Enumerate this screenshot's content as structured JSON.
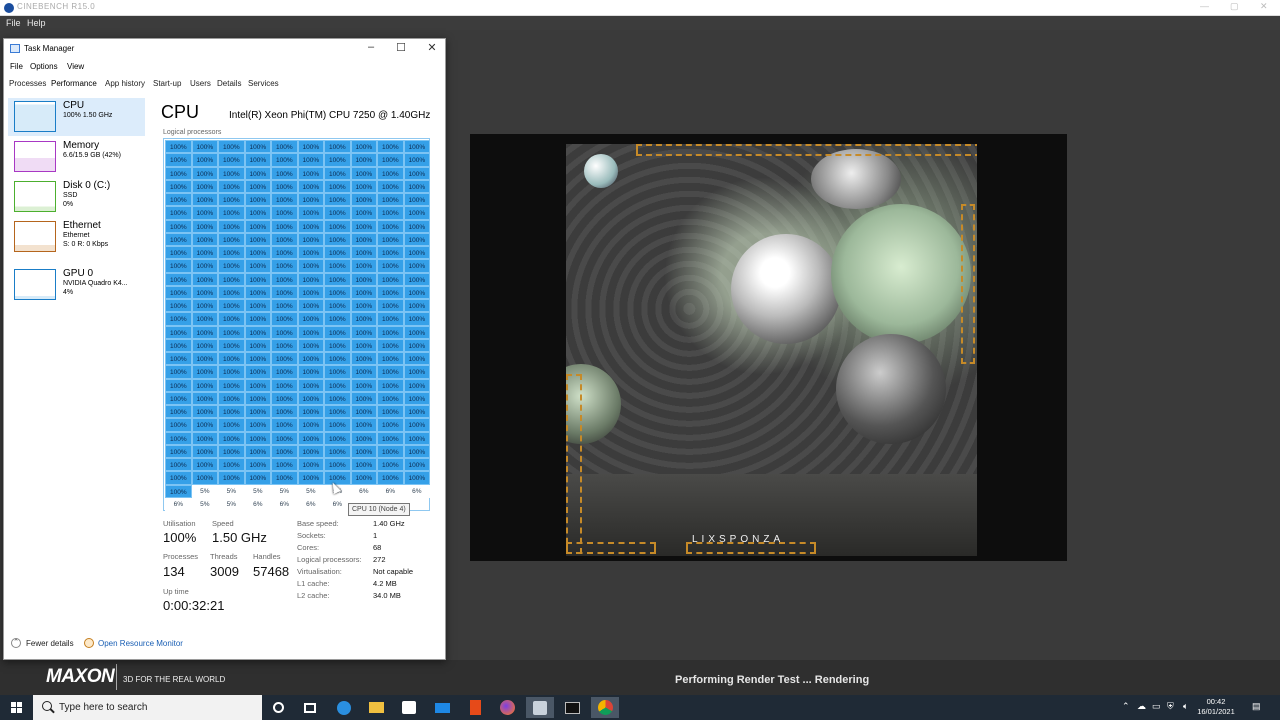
{
  "host": {
    "title": "CINEBENCH R15.0",
    "menu": [
      "File",
      "Help"
    ],
    "bottom_logo": "MAXON",
    "bottom_tagline": "3D FOR THE REAL WORLD",
    "status": "Performing Render Test ... Rendering",
    "render_brand": "LIXSPONZA"
  },
  "taskmgr": {
    "title": "Task Manager",
    "menu": [
      "File",
      "Options",
      "View"
    ],
    "tabs": [
      "Processes",
      "Performance",
      "App history",
      "Start-up",
      "Users",
      "Details",
      "Services"
    ],
    "active_tab": "Performance",
    "sidebar": [
      {
        "name": "CPU",
        "s1": "100% 1.50 GHz",
        "s2": "",
        "color": "#1a7dc7"
      },
      {
        "name": "Memory",
        "s1": "6.6/15.9 GB (42%)",
        "s2": "",
        "color": "#a838c4"
      },
      {
        "name": "Disk 0 (C:)",
        "s1": "SSD",
        "s2": "0%",
        "color": "#4caf2e"
      },
      {
        "name": "Ethernet",
        "s1": "Ethernet",
        "s2": "S: 0 R: 0 Kbps",
        "color": "#b5651d"
      },
      {
        "name": "GPU 0",
        "s1": "NVIDIA Quadro K4...",
        "s2": "4%",
        "color": "#1a7dc7"
      }
    ],
    "cpu_heading": "CPU",
    "cpu_model": "Intel(R) Xeon Phi(TM) CPU 7250 @ 1.40GHz",
    "lp_label": "Logical processors",
    "lp_busy_label": "100%",
    "lp_busy_count": 261,
    "lp_idle_values": [
      "5%",
      "5%",
      "5%",
      "5%",
      "5%",
      "5%",
      "6%",
      "6%",
      "6%",
      "6%",
      "5%",
      "5%",
      "6%",
      "6%",
      "6%",
      "6%"
    ],
    "tooltip": "CPU 10 (Node 4)",
    "stats": {
      "utilisation_label": "Utilisation",
      "utilisation": "100%",
      "speed_label": "Speed",
      "speed": "1.50 GHz",
      "processes_label": "Processes",
      "processes": "134",
      "threads_label": "Threads",
      "threads": "3009",
      "handles_label": "Handles",
      "handles": "57468",
      "uptime_label": "Up time",
      "uptime": "0:00:32:21"
    },
    "details": [
      {
        "k": "Base speed:",
        "v": "1.40 GHz"
      },
      {
        "k": "Sockets:",
        "v": "1"
      },
      {
        "k": "Cores:",
        "v": "68"
      },
      {
        "k": "Logical processors:",
        "v": "272"
      },
      {
        "k": "Virtualisation:",
        "v": "Not capable"
      },
      {
        "k": "L1 cache:",
        "v": "4.2 MB"
      },
      {
        "k": "L2 cache:",
        "v": "34.0 MB"
      }
    ],
    "fewer_details": "Fewer details",
    "open_resource_monitor": "Open Resource Monitor"
  },
  "taskbar": {
    "search_placeholder": "Type here to search",
    "time": "00:42",
    "date": "16/01/2021",
    "icons": [
      "cortana-icon",
      "task-view-icon",
      "edge-icon",
      "file-explorer-icon",
      "store-icon",
      "mail-icon",
      "office-icon",
      "firefox-icon",
      "cinebench-icon",
      "terminal-icon",
      "chrome-icon"
    ]
  }
}
